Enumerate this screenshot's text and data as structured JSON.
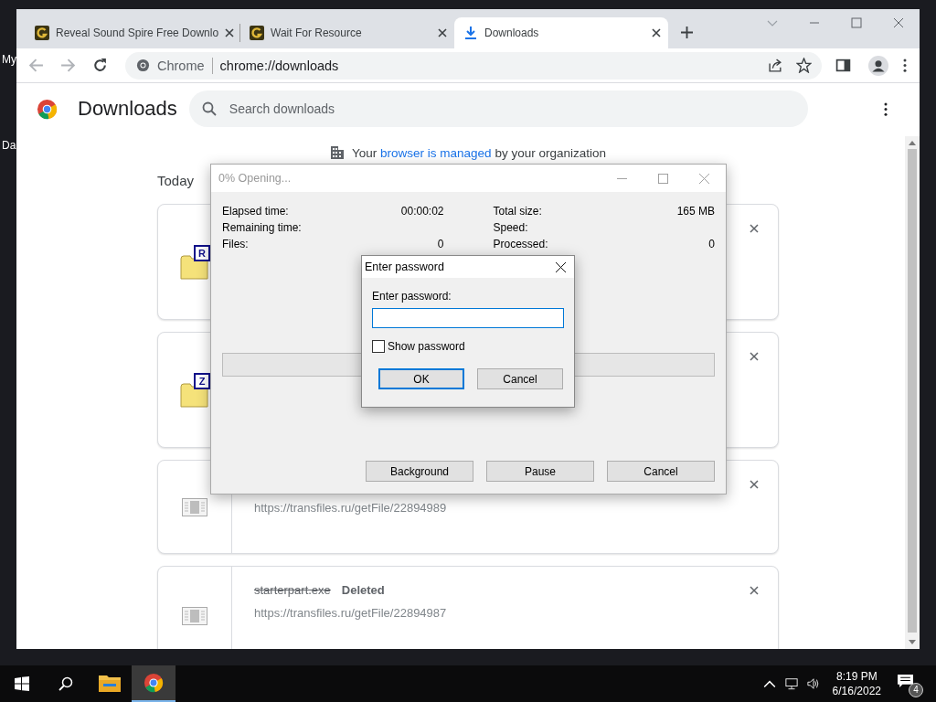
{
  "desktop": {
    "icon_labels": [
      "My",
      "Da"
    ]
  },
  "browser": {
    "tabs": [
      {
        "title": "Reveal Sound Spire Free Downlo",
        "kind": "site",
        "selected": false
      },
      {
        "title": "Wait For Resource",
        "kind": "site",
        "selected": false
      },
      {
        "title": "Downloads",
        "kind": "download",
        "selected": true
      }
    ],
    "omnibox": {
      "site": "Chrome",
      "url": "chrome://downloads"
    }
  },
  "page": {
    "title": "Downloads",
    "search": {
      "placeholder": "Search downloads"
    },
    "managed_notice": {
      "before": "Your",
      "link": "browser is managed",
      "after": "by your organization"
    },
    "date_heading": "Today",
    "downloads": [
      {
        "kind": "archive",
        "badge": "R"
      },
      {
        "kind": "archive",
        "badge": "Z"
      },
      {
        "kind": "file",
        "url": "https://transfiles.ru/getFile/22894989"
      },
      {
        "kind": "file",
        "name": "starterpart.exe",
        "status": "Deleted",
        "deleted": true,
        "url": "https://transfiles.ru/getFile/22894987"
      }
    ]
  },
  "progress_dialog": {
    "title": "0% Opening...",
    "active": false,
    "stats_left": [
      {
        "label": "Elapsed time:",
        "value": "00:00:02"
      },
      {
        "label": "Remaining time:"
      },
      {
        "label": "Files:",
        "value": "0"
      }
    ],
    "stats_right": [
      {
        "label": "Total size:",
        "value": "165 MB"
      },
      {
        "label": "Speed:"
      },
      {
        "label": "Processed:",
        "value": "0"
      }
    ],
    "level": 0,
    "buttons": [
      "Background",
      "Pause",
      "Cancel"
    ]
  },
  "password_dialog": {
    "title": "Enter password",
    "label": "Enter password:",
    "show_password": {
      "label": "Show password",
      "checked": false
    },
    "buttons": [
      {
        "label": "OK",
        "default": true
      },
      {
        "label": "Cancel",
        "default": false
      }
    ]
  },
  "taskbar": {
    "apps": [
      {
        "kind": "explorer",
        "active": false
      },
      {
        "kind": "chrome",
        "active": true
      }
    ],
    "clock": {
      "time": "8:19 PM",
      "date": "6/16/2022"
    },
    "notification_count": "4"
  }
}
